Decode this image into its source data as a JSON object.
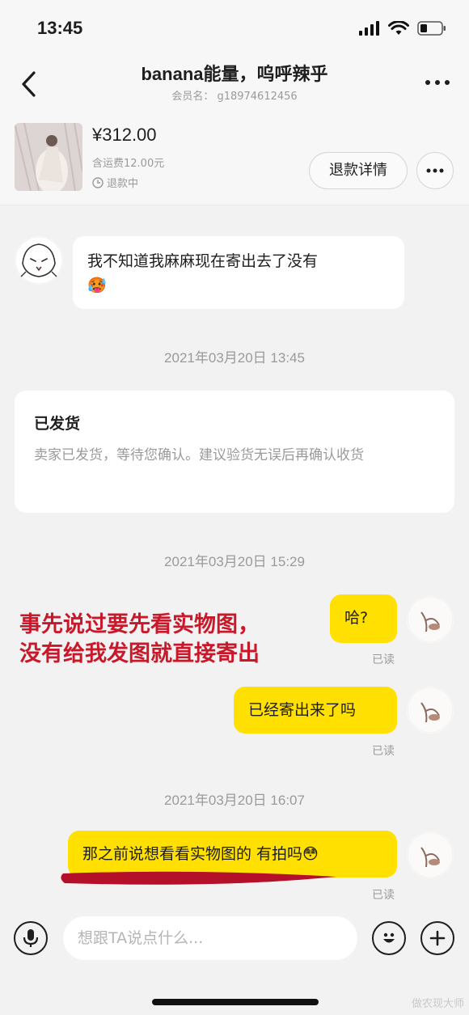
{
  "status": {
    "time": "13:45"
  },
  "nav": {
    "title": "banana能量，呜呼辣乎",
    "member": "会员名： g18974612456"
  },
  "product": {
    "price": "¥312.00",
    "shipping": "含运费12.00元",
    "refund_status": "退款中",
    "refund_button": "退款详情"
  },
  "messages": {
    "incoming_1": "我不知道我麻麻现在寄出去了没有",
    "incoming_1_emoji": "🥵",
    "ts1": "2021年03月20日 13:45",
    "system_title": "已发货",
    "system_body": "卖家已发货，等待您确认。建议验货无误后再确认收货",
    "ts2": "2021年03月20日 15:29",
    "outgoing_1": "哈?",
    "outgoing_2": "已经寄出来了吗",
    "ts3": "2021年03月20日 16:07",
    "outgoing_3": "那之前说想看看实物图的 有拍吗",
    "outgoing_3_emoji": "😳",
    "read_label": "已读"
  },
  "annotation": {
    "line1": "事先说过要先看实物图，",
    "line2": "没有给我发图就直接寄出"
  },
  "input": {
    "placeholder": "想跟TA说点什么..."
  },
  "watermark": "做农现大师",
  "colors": {
    "bubble_self": "#ffe000",
    "annotation": "#c8182a",
    "background": "#f2f2f2"
  }
}
